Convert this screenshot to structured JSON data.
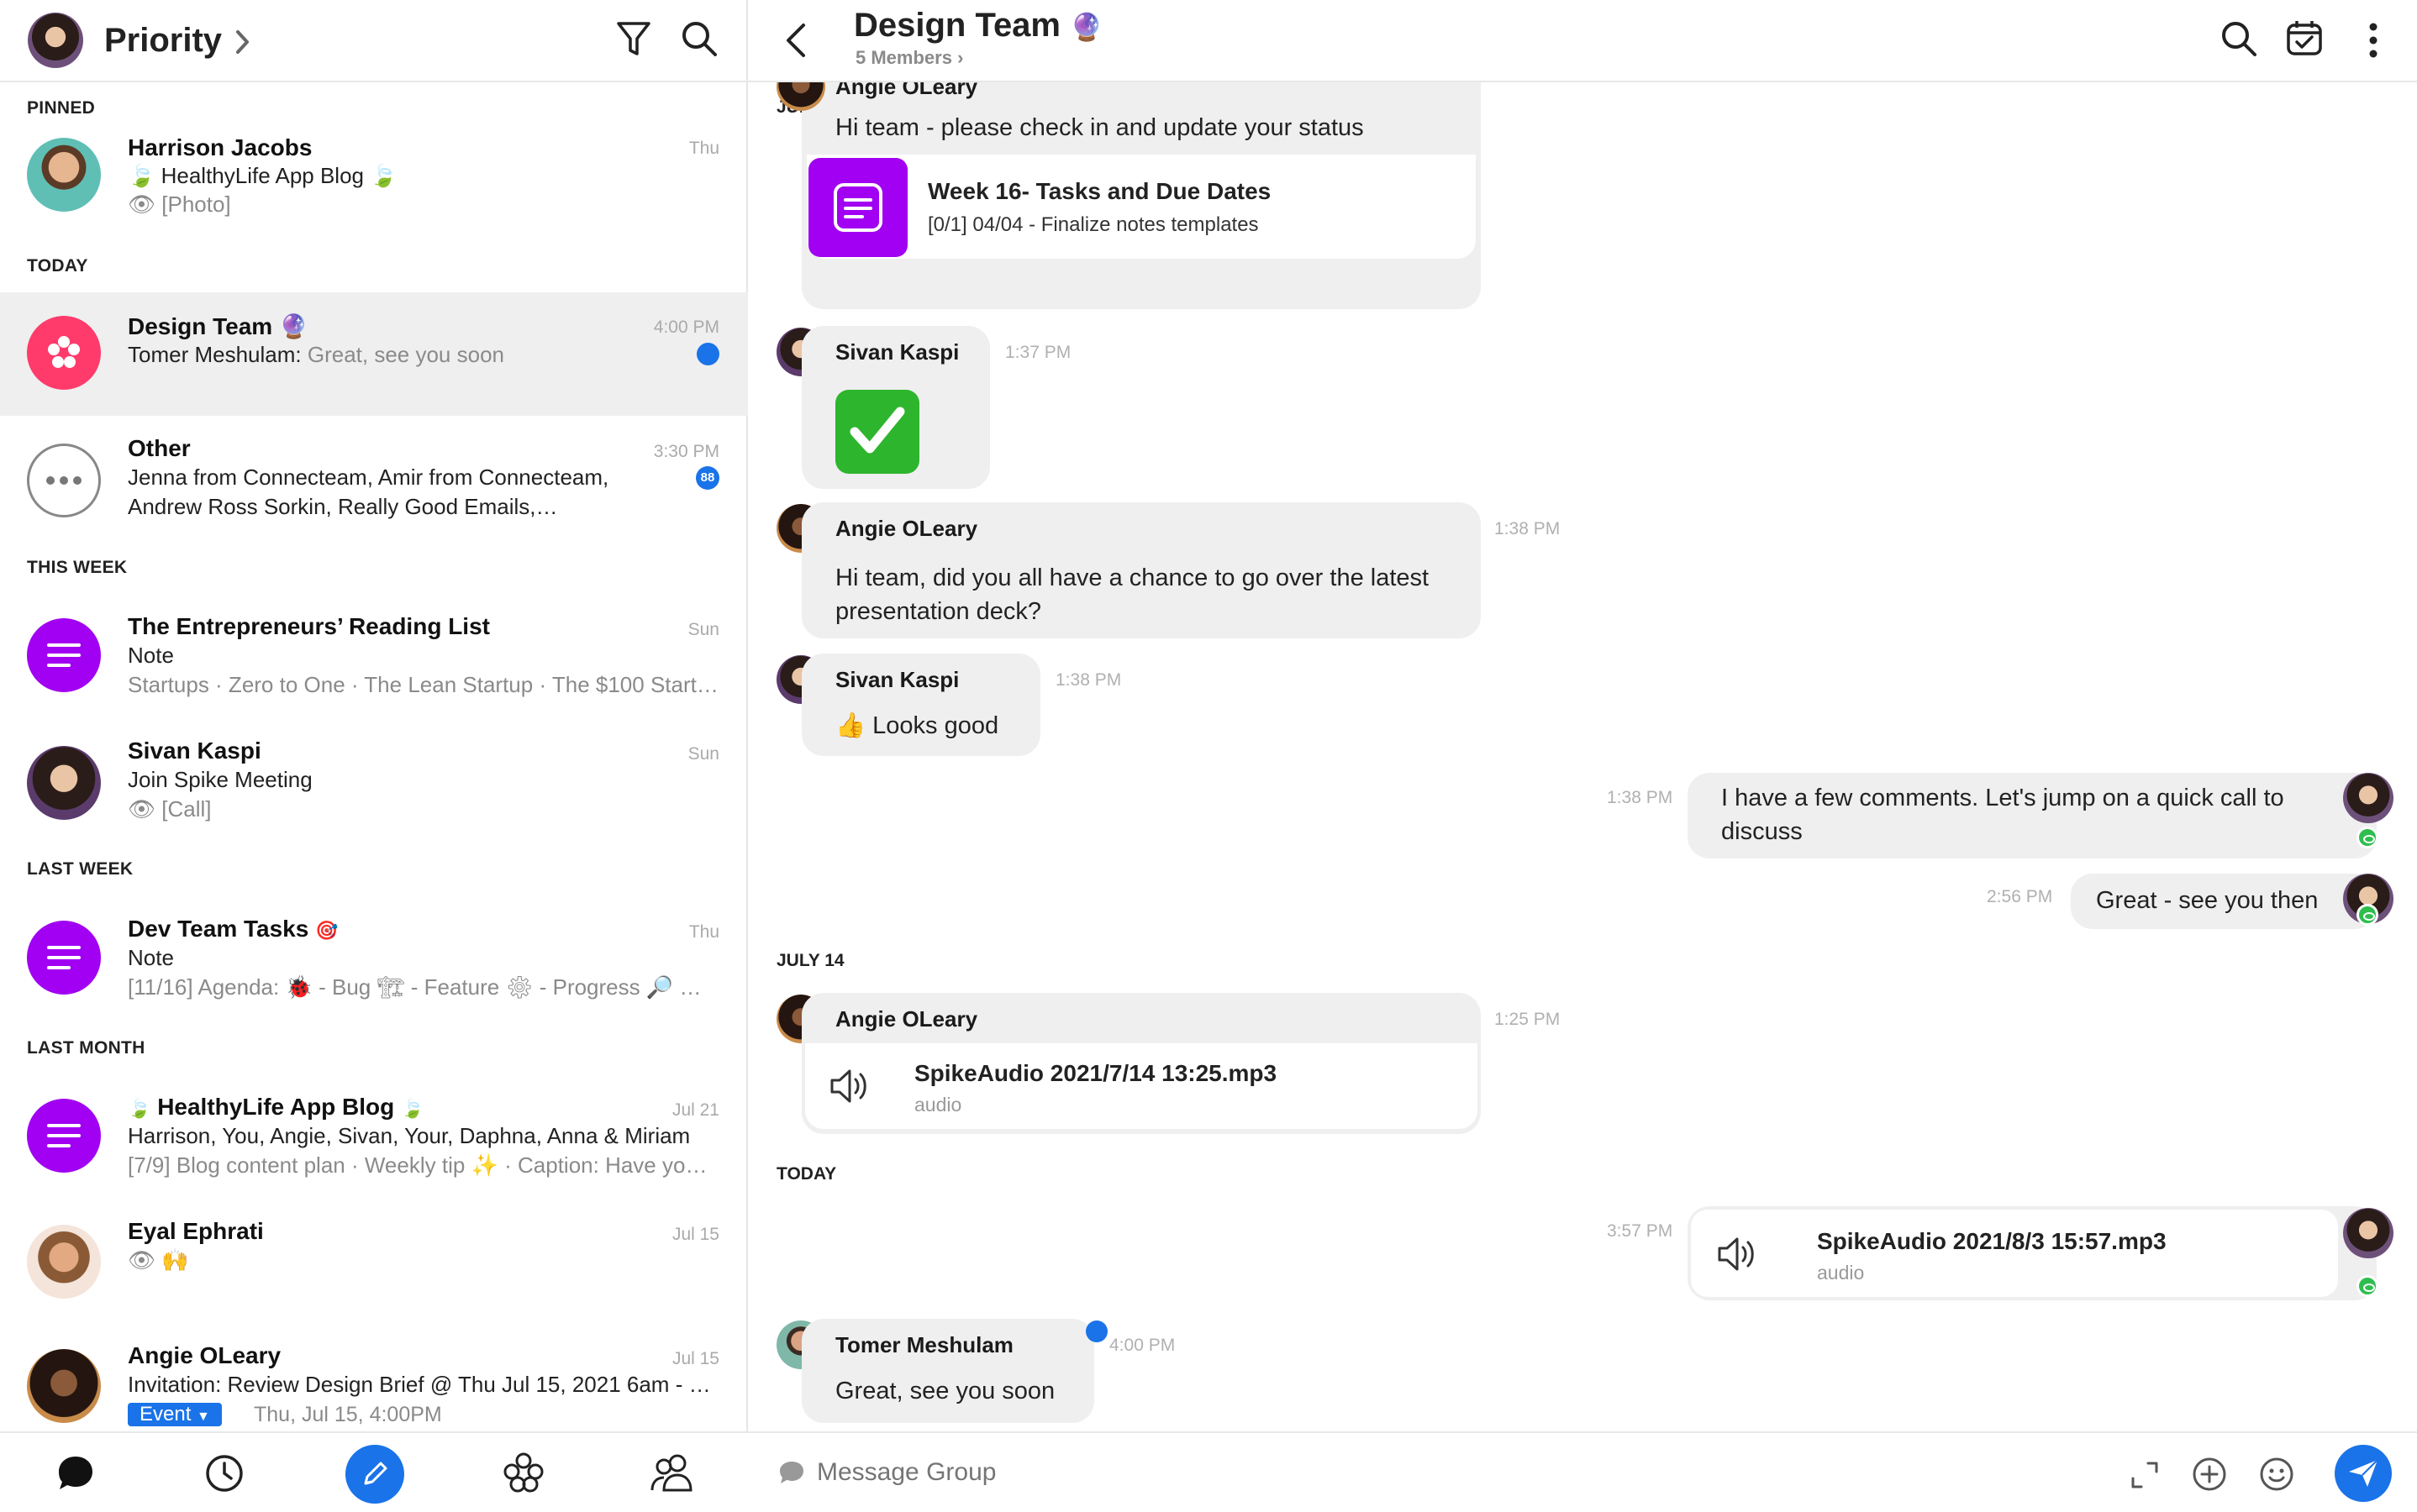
{
  "sidebar": {
    "header": {
      "title": "Priority"
    },
    "sections": {
      "pinned": "PINNED",
      "today": "TODAY",
      "this_week": "THIS WEEK",
      "last_week": "LAST WEEK",
      "last_month": "LAST MONTH"
    },
    "conversations": [
      {
        "title": "Harrison Jacobs",
        "line1": "HealthyLife App Blog",
        "line2": "[Photo]",
        "time": "Thu"
      },
      {
        "title": "Design Team",
        "sender": "Tomer Meshulam:",
        "preview": "Great, see you soon",
        "time": "4:00 PM"
      },
      {
        "title": "Other",
        "line1": "Jenna from Connecteam, Amir from Connecteam,",
        "line2": "Andrew Ross Sorkin, Really Good Emails,…",
        "time": "3:30 PM",
        "badge": "88"
      },
      {
        "title": "The Entrepreneurs’ Reading List",
        "line1": "Note",
        "line2": "Startups · Zero to One · The Lean Startup · The $100 Start…",
        "time": "Sun"
      },
      {
        "title": "Sivan Kaspi",
        "line1": "Join Spike Meeting",
        "line2": "[Call]",
        "time": "Sun"
      },
      {
        "title": "Dev Team Tasks",
        "line1": "Note",
        "line2a": "[11/16] Agenda:",
        "line2b": "- Bug",
        "line2c": "- Feature",
        "line2d": "- Progress",
        "time": "Thu"
      },
      {
        "title": "HealthyLife App Blog",
        "line1": "Harrison, You, Angie, Sivan, Your, Daphna, Anna & Miriam",
        "line2": "[7/9] Blog content plan · Weekly tip ✨ · Caption: Have yo…",
        "time": "Jul 21"
      },
      {
        "title": "Eyal Ephrati",
        "line1": "",
        "time": "Jul 15"
      },
      {
        "title": "Angie OLeary",
        "line1": "Invitation: Review Design Brief @ Thu Jul 15, 2021 6am - 7…",
        "event_label": "Event",
        "event_time": "Thu, Jul 15, 4:00PM",
        "time": "Jul 15"
      }
    ]
  },
  "chat": {
    "header": {
      "title": "Design Team",
      "members": "5 Members"
    },
    "dates": {
      "june": "JUNE 13",
      "july": "JULY 14",
      "today": "TODAY"
    },
    "messages": {
      "m1": {
        "sender": "Angie OLeary",
        "text": "Hi team - please check in and update your status",
        "card_title": "Week 16- Tasks and Due Dates",
        "card_sub": "[0/1] 04/04 - Finalize notes templates"
      },
      "m2": {
        "sender": "Sivan Kaspi",
        "time": "1:37 PM"
      },
      "m3": {
        "sender": "Angie OLeary",
        "time": "1:38 PM",
        "text": "Hi team, did you all have a chance to go over the latest presentation deck?"
      },
      "m4": {
        "sender": "Sivan Kaspi",
        "time": "1:38 PM",
        "text": "Looks good"
      },
      "m5": {
        "time": "1:38 PM",
        "text": "I have a few comments. Let's jump on a quick call to discuss"
      },
      "m6": {
        "time": "2:56 PM",
        "text": "Great - see you then"
      },
      "m7": {
        "sender": "Angie OLeary",
        "time": "1:25 PM",
        "file": "SpikeAudio 2021/7/14 13:25.mp3",
        "kind": "audio"
      },
      "m8": {
        "time": "3:57 PM",
        "file": "SpikeAudio 2021/8/3 15:57.mp3",
        "kind": "audio"
      },
      "m9": {
        "sender": "Tomer Meshulam",
        "time": "4:00 PM",
        "text": "Great, see you soon"
      }
    },
    "composer": {
      "placeholder": "Message Group"
    }
  },
  "colors": {
    "accent": "#1a73e8",
    "purple": "#a100f2",
    "pink": "#ff3b6b",
    "seen": "#2fbe4e"
  }
}
